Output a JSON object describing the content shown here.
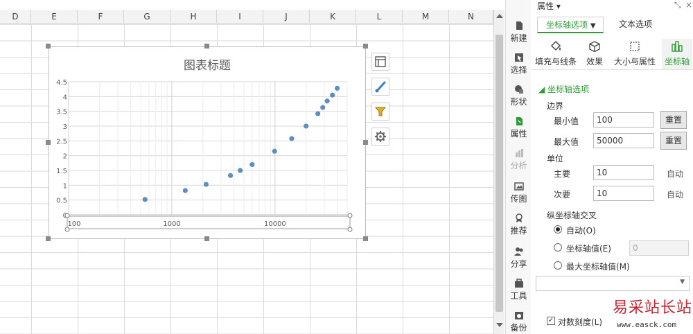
{
  "sheet": {
    "columns": [
      "D",
      "E",
      "F",
      "G",
      "H",
      "I",
      "J",
      "K",
      "L",
      "M",
      "N"
    ]
  },
  "chart_data": {
    "type": "scatter",
    "title": "图表标题",
    "xlabel": "",
    "ylabel": "",
    "x_scale": "log",
    "xlim": [
      100,
      50000
    ],
    "ylim": [
      0,
      4.5
    ],
    "x_ticks": [
      "100",
      "1000",
      "10000"
    ],
    "y_ticks": [
      "0",
      "0.5",
      "1",
      "1.5",
      "2",
      "2.5",
      "3",
      "3.5",
      "4",
      "4.5"
    ],
    "grid": true,
    "marker_color": "#5b8fbf",
    "series": [
      {
        "x": [
          550,
          1350,
          2150,
          3700,
          4600,
          6000,
          9900,
          14500,
          20000,
          26000,
          29000,
          32000,
          36000,
          40000
        ],
        "y": [
          0.52,
          0.82,
          1.03,
          1.33,
          1.5,
          1.7,
          2.15,
          2.58,
          3.0,
          3.42,
          3.63,
          3.85,
          4.05,
          4.28
        ]
      }
    ]
  },
  "chart_buttons": [
    "chart-elements-icon",
    "chart-style-icon",
    "chart-filter-icon",
    "chart-settings-icon"
  ],
  "iconbar": {
    "items": [
      {
        "label": "新建",
        "icon": "new-icon"
      },
      {
        "label": "选择",
        "icon": "select-icon"
      },
      {
        "label": "形状",
        "icon": "shape-icon"
      },
      {
        "label": "属性",
        "icon": "properties-icon"
      },
      {
        "label": "分析",
        "icon": "analysis-icon"
      },
      {
        "label": "传图",
        "icon": "upload-image-icon"
      },
      {
        "label": "推荐",
        "icon": "recommend-icon"
      },
      {
        "label": "分享",
        "icon": "share-icon"
      },
      {
        "label": "工具",
        "icon": "tools-icon"
      },
      {
        "label": "备份",
        "icon": "backup-icon"
      }
    ]
  },
  "pane": {
    "title": "属性 ▾",
    "tabs": [
      "坐标轴选项",
      "文本选项"
    ],
    "subtabs": [
      "填充与线条",
      "效果",
      "大小与属性",
      "坐标轴"
    ],
    "section_axis": "◢ 坐标轴选项",
    "bounds_label": "边界",
    "min_label": "最小值",
    "min_value": "100",
    "max_label": "最大值",
    "max_value": "50000",
    "reset_label": "重置",
    "units_label": "单位",
    "major_label": "主要",
    "major_value": "10",
    "minor_label": "次要",
    "minor_value": "10",
    "auto_label": "自动",
    "cross_label": "纵坐标轴交叉",
    "radio_auto": "自动(O)",
    "radio_value": "坐标轴值(E)",
    "radio_value_input": "0",
    "radio_max": "最大坐标轴值(M)",
    "log_label": "对数刻度(L)",
    "accent": "#2e9b38"
  },
  "watermark": {
    "logo": "易采站长站",
    "url": "www.easck.com"
  }
}
